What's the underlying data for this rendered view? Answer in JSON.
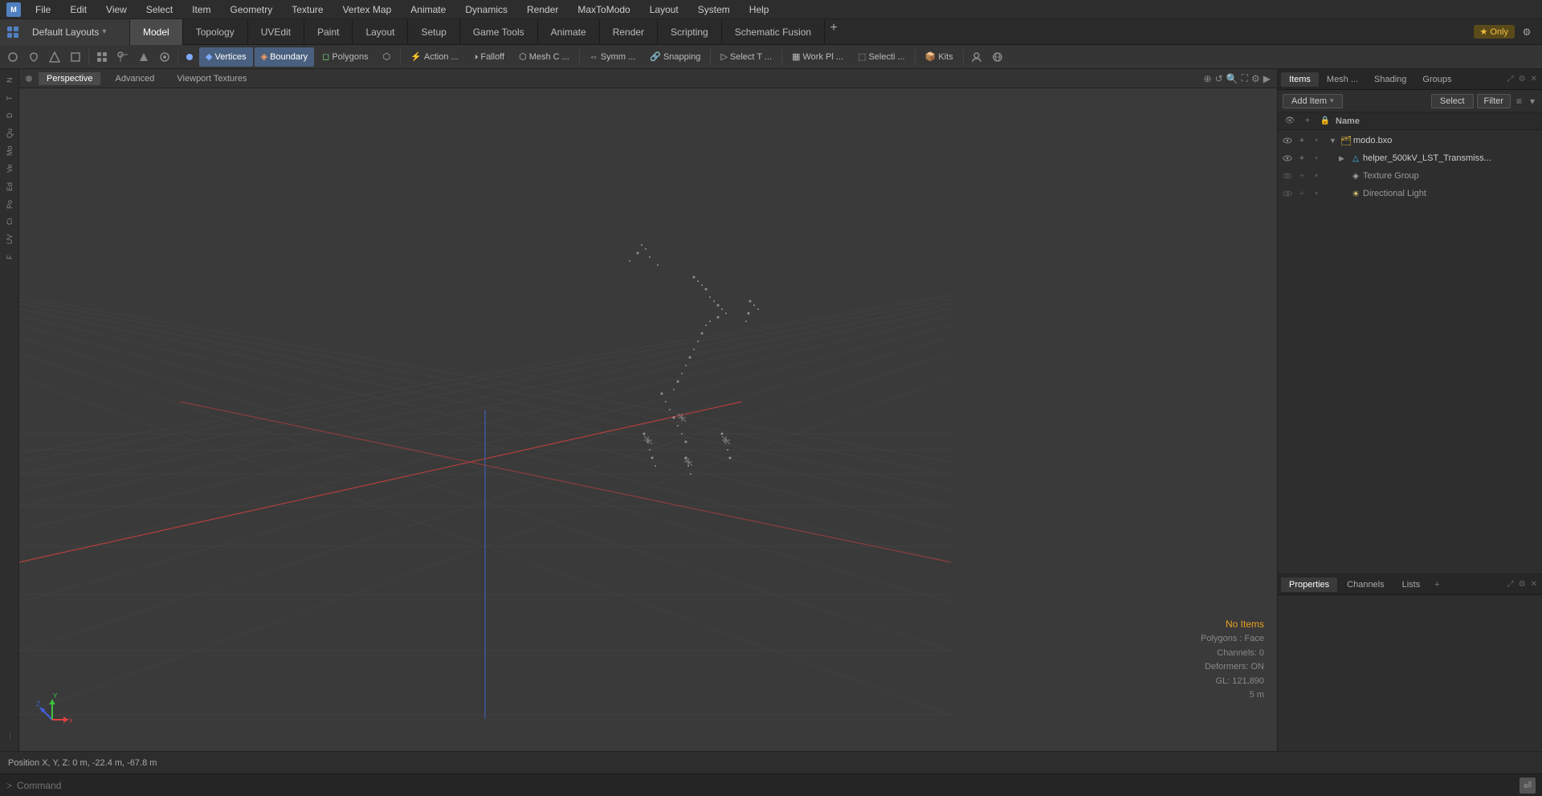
{
  "app": {
    "title": "MODO"
  },
  "menu": {
    "items": [
      "File",
      "Edit",
      "View",
      "Select",
      "Item",
      "Geometry",
      "Texture",
      "Vertex Map",
      "Animate",
      "Dynamics",
      "Render",
      "MaxToModo",
      "Layout",
      "System",
      "Help"
    ]
  },
  "layout": {
    "current": "Default Layouts",
    "tabs": [
      "Model",
      "Topology",
      "UVEdit",
      "Paint",
      "Layout",
      "Setup",
      "Game Tools",
      "Animate",
      "Render",
      "Scripting",
      "Schematic Fusion"
    ],
    "active_tab": "Model",
    "plus_label": "+",
    "only_label": "Only",
    "gear_icon": "⚙"
  },
  "toolbar": {
    "items": [
      {
        "label": "Vertices",
        "icon": "◆",
        "active": false
      },
      {
        "label": "Boundary",
        "icon": "◈",
        "active": true
      },
      {
        "label": "Polygons",
        "icon": "◻",
        "active": false
      },
      {
        "label": "",
        "icon": "⬡",
        "active": false
      },
      {
        "label": "Action ...",
        "icon": "⚡",
        "active": false
      },
      {
        "label": "Falloff",
        "icon": "◑",
        "active": false
      },
      {
        "label": "Mesh C ...",
        "icon": "⬡",
        "active": false
      },
      {
        "label": "Symm ...",
        "icon": "⇔",
        "active": false
      },
      {
        "label": "Snapping",
        "icon": "🔒",
        "active": false
      },
      {
        "label": "Select T ...",
        "icon": "▷",
        "active": false
      },
      {
        "label": "Work Pl ...",
        "icon": "▦",
        "active": false
      },
      {
        "label": "Selecti ...",
        "icon": "⬚",
        "active": false
      },
      {
        "label": "Kits",
        "icon": "📦",
        "active": false
      }
    ]
  },
  "viewport": {
    "tabs": [
      "Perspective",
      "Advanced",
      "Viewport Textures"
    ],
    "active_tab": "Perspective",
    "status": {
      "no_items": "No Items",
      "polygons": "Polygons : Face",
      "channels": "Channels: 0",
      "deformers": "Deformers: ON",
      "gl": "GL: 121,890",
      "scale": "5 m"
    }
  },
  "position_bar": {
    "text": "Position X, Y, Z:  0 m, -22.4 m, -67.8 m"
  },
  "items_panel": {
    "tabs": [
      "Items",
      "Mesh ...",
      "Shading",
      "Groups"
    ],
    "active_tab": "Items",
    "add_item_label": "Add Item",
    "select_label": "Select",
    "filter_label": "Filter",
    "name_col": "Name",
    "items": [
      {
        "id": "modo-bxo",
        "label": "modo.bxo",
        "level": 0,
        "expanded": true,
        "icon": "🗂",
        "icon_color": "#f0c040",
        "visible": true,
        "children": [
          {
            "id": "helper-mesh",
            "label": "helper_500kV_LST_Transmiss...",
            "level": 1,
            "expanded": false,
            "icon": "△",
            "icon_color": "#40c0f0",
            "visible": true
          },
          {
            "id": "texture-group",
            "label": "Texture Group",
            "level": 1,
            "expanded": false,
            "icon": "◈",
            "icon_color": "#aaa",
            "visible": false
          },
          {
            "id": "directional-light",
            "label": "Directional Light",
            "level": 1,
            "expanded": false,
            "icon": "☀",
            "icon_color": "#f0e080",
            "visible": false
          }
        ]
      }
    ]
  },
  "properties_panel": {
    "tabs": [
      "Properties",
      "Channels",
      "Lists"
    ],
    "active_tab": "Properties",
    "plus_label": "+"
  },
  "command_bar": {
    "prompt": ">",
    "placeholder": "Command",
    "icon": "⏎"
  },
  "left_sidebar": {
    "tools": [
      "N",
      "T",
      "D",
      "Qu",
      "Mo",
      "Ve",
      "Ed",
      "Po",
      "Ci",
      "UV",
      "F"
    ]
  }
}
